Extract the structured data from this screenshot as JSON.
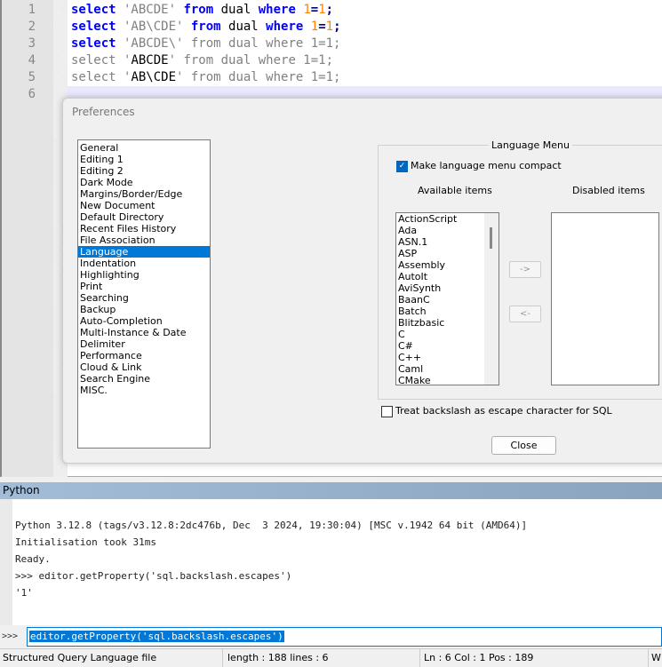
{
  "editor": {
    "line_numbers": [
      "1",
      "2",
      "3",
      "4",
      "5",
      "6"
    ],
    "lines": [
      [
        {
          "t": "select",
          "c": "kw"
        },
        {
          "t": " 'ABCDE' ",
          "c": "str"
        },
        {
          "t": "from",
          "c": "kw"
        },
        {
          "t": " dual ",
          "c": "blk"
        },
        {
          "t": "where",
          "c": "kw"
        },
        {
          "t": " ",
          "c": "str"
        },
        {
          "t": "1",
          "c": "num"
        },
        {
          "t": "=",
          "c": "op"
        },
        {
          "t": "1",
          "c": "num"
        },
        {
          "t": ";",
          "c": "op"
        }
      ],
      [
        {
          "t": "select",
          "c": "kw"
        },
        {
          "t": " 'AB\\CDE' ",
          "c": "str"
        },
        {
          "t": "from",
          "c": "kw"
        },
        {
          "t": " dual ",
          "c": "blk"
        },
        {
          "t": "where",
          "c": "kw"
        },
        {
          "t": " ",
          "c": "str"
        },
        {
          "t": "1",
          "c": "num"
        },
        {
          "t": "=",
          "c": "op"
        },
        {
          "t": "1",
          "c": "num"
        },
        {
          "t": ";",
          "c": "op"
        }
      ],
      [
        {
          "t": "select",
          "c": "kw"
        },
        {
          "t": " 'ABCDE\\' from dual where 1=1;",
          "c": "str"
        }
      ],
      [
        {
          "t": "select '",
          "c": "str"
        },
        {
          "t": "ABCDE",
          "c": "blk"
        },
        {
          "t": "' from dual where 1=1;",
          "c": "str"
        }
      ],
      [
        {
          "t": "select '",
          "c": "str"
        },
        {
          "t": "AB\\CDE",
          "c": "blk"
        },
        {
          "t": "' from dual where 1=1;",
          "c": "str"
        }
      ],
      []
    ]
  },
  "dialog": {
    "title": "Preferences",
    "categories": [
      "General",
      "Editing 1",
      "Editing 2",
      "Dark Mode",
      "Margins/Border/Edge",
      "New Document",
      "Default Directory",
      "Recent Files History",
      "File Association",
      "Language",
      "Indentation",
      "Highlighting",
      "Print",
      "Searching",
      "Backup",
      "Auto-Completion",
      "Multi-Instance & Date",
      "Delimiter",
      "Performance",
      "Cloud & Link",
      "Search Engine",
      "MISC."
    ],
    "selected_category": "Language",
    "group_title": "Language Menu",
    "compact_label": "Make language menu compact",
    "compact_checked": true,
    "available_label": "Available items",
    "disabled_label": "Disabled items",
    "available_items": [
      "ActionScript",
      "Ada",
      "ASN.1",
      "ASP",
      "Assembly",
      "AutoIt",
      "AviSynth",
      "BaanC",
      "Batch",
      "Blitzbasic",
      "C",
      "C#",
      "C++",
      "Caml",
      "CMake"
    ],
    "disabled_items": [],
    "move_right": "->",
    "move_left": "<-",
    "backslash_label": "Treat backslash as escape character for SQL",
    "backslash_checked": false,
    "close": "Close"
  },
  "python": {
    "title": "Python",
    "console": [
      "Python 3.12.8 (tags/v3.12.8:2dc476b, Dec  3 2024, 19:30:04) [MSC v.1942 64 bit (AMD64)]",
      "Initialisation took 31ms",
      "Ready.",
      ">>> editor.getProperty('sql.backslash.escapes')",
      "'1'"
    ],
    "prompt": ">>>",
    "input": "editor.getProperty('sql.backslash.escapes')"
  },
  "status": {
    "file_type": "Structured Query Language file",
    "length": "length : 188    lines : 6",
    "position": "Ln : 6    Col : 1    Pos : 189",
    "eol": "W"
  }
}
